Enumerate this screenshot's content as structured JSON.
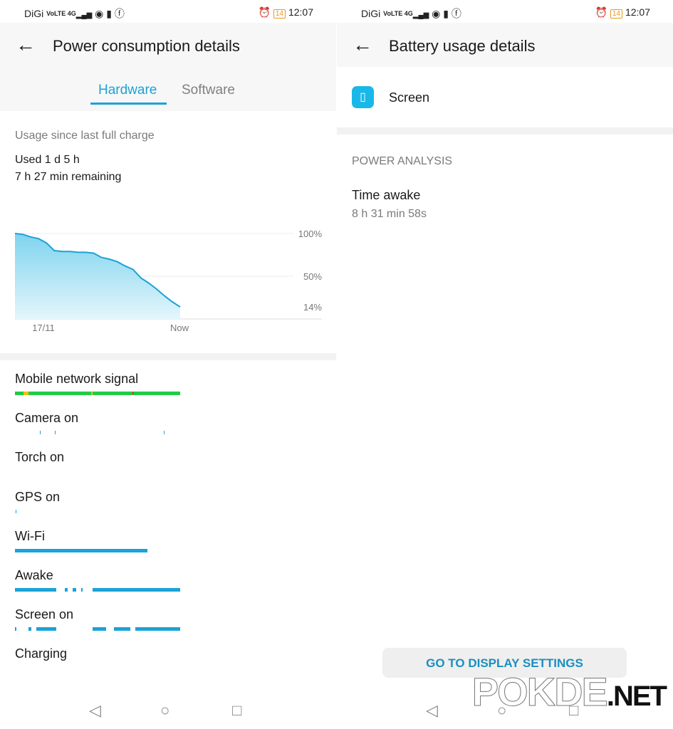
{
  "status_bar": {
    "carrier": "DiGi",
    "network": "VoLTE 4G",
    "battery": "14",
    "time": "12:07"
  },
  "left": {
    "title": "Power consumption details",
    "tabs": [
      {
        "label": "Hardware",
        "active": true
      },
      {
        "label": "Software",
        "active": false
      }
    ],
    "usage_label": "Usage since last full charge",
    "used": "Used 1 d 5 h",
    "remaining": "7 h 27 min remaining",
    "chart_data": {
      "type": "area",
      "x_labels": [
        "17/11",
        "Now"
      ],
      "y_ticks": [
        "100%",
        "50%",
        "14%"
      ],
      "ylim": [
        0,
        100
      ],
      "values": [
        100,
        99,
        96,
        94,
        89,
        80,
        79,
        79,
        78,
        78,
        77,
        72,
        70,
        67,
        62,
        58,
        48,
        42,
        35,
        27,
        20,
        14
      ],
      "color": "#1aa3d6"
    },
    "timelines": [
      {
        "label": "Mobile network signal",
        "color": "#22cc44",
        "segments": [
          [
            0,
            1
          ]
        ],
        "marks": [
          [
            0.05,
            0.08,
            "#f2c000"
          ],
          [
            0.46,
            0.47,
            "#f2c000"
          ],
          [
            0.71,
            0.72,
            "#e04040"
          ]
        ]
      },
      {
        "label": "Camera on",
        "color": "#1aa3d6",
        "segments": [
          [
            0.15,
            0.155
          ],
          [
            0.24,
            0.245
          ],
          [
            0.9,
            0.905
          ]
        ]
      },
      {
        "label": "Torch on",
        "color": "#1aa3d6",
        "segments": []
      },
      {
        "label": "GPS on",
        "color": "#1aa3d6",
        "segments": [
          [
            0.005,
            0.01
          ]
        ]
      },
      {
        "label": "Wi-Fi",
        "color": "#1aa3d6",
        "segments": [
          [
            0,
            0.8
          ]
        ]
      },
      {
        "label": "Awake",
        "color": "#1aa3d6",
        "segments": [
          [
            0,
            0.25
          ],
          [
            0.3,
            0.32
          ],
          [
            0.35,
            0.37
          ],
          [
            0.4,
            0.41
          ],
          [
            0.47,
            1
          ]
        ]
      },
      {
        "label": "Screen on",
        "color": "#1aa3d6",
        "segments": [
          [
            0,
            0.01
          ],
          [
            0.08,
            0.1
          ],
          [
            0.13,
            0.25
          ],
          [
            0.47,
            0.55
          ],
          [
            0.6,
            0.7
          ],
          [
            0.73,
            1
          ]
        ]
      },
      {
        "label": "Charging",
        "color": "#1aa3d6",
        "segments": []
      }
    ]
  },
  "right": {
    "title": "Battery usage details",
    "app_name": "Screen",
    "section": "POWER ANALYSIS",
    "time_awake_label": "Time awake",
    "time_awake_value": "8 h 31 min 58s",
    "button": "GO TO DISPLAY SETTINGS"
  },
  "watermark": "POKDE.NET"
}
